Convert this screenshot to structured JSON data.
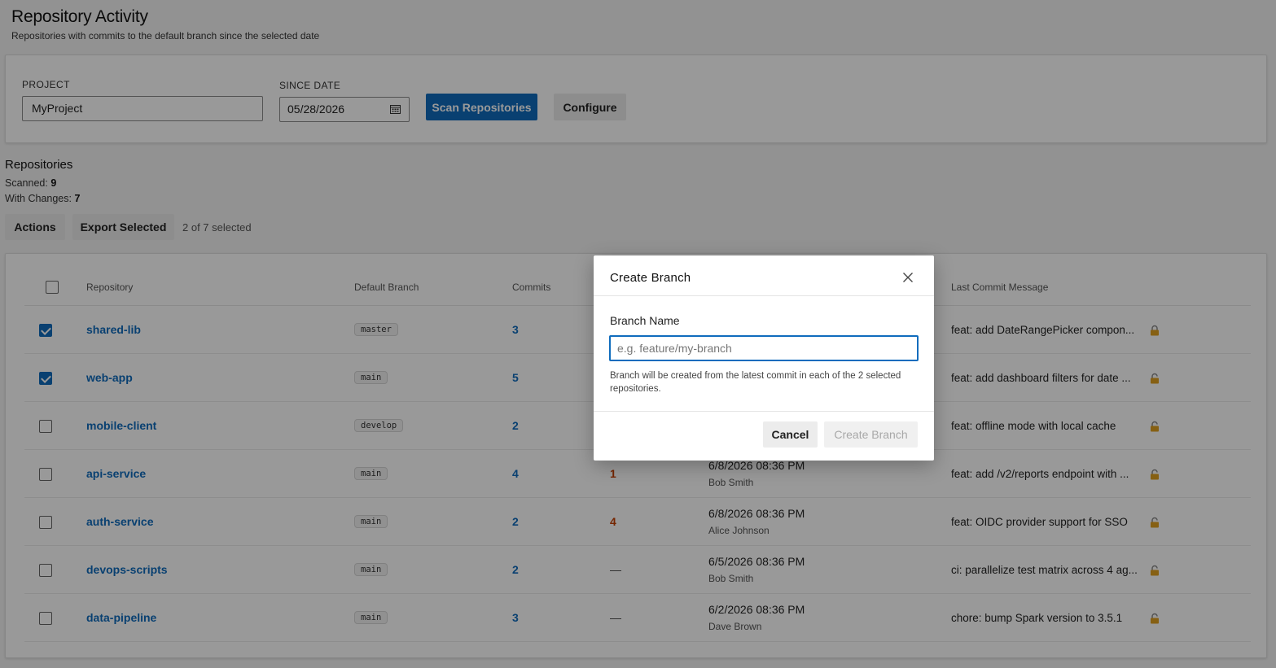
{
  "page": {
    "title": "Repository Activity",
    "subtitle": "Repositories with commits to the default branch since the selected date"
  },
  "filters": {
    "project_label": "PROJECT",
    "project_value": "MyProject",
    "since_label": "SINCE DATE",
    "since_value": "05/28/2026",
    "scan_button": "Scan Repositories",
    "configure_button": "Configure"
  },
  "summary": {
    "section_title": "Repositories",
    "scanned_label": "Scanned:",
    "scanned_value": "9",
    "changes_label": "With Changes:",
    "changes_value": "7",
    "actions_button": "Actions",
    "export_button": "Export Selected",
    "selected_text": "2 of 7 selected"
  },
  "table": {
    "headers": {
      "repository": "Repository",
      "default_branch": "Default Branch",
      "commits": "Commits",
      "last_commit_message": "Last Commit Message"
    },
    "rows": [
      {
        "selected": true,
        "repo": "shared-lib",
        "branch": "master",
        "commits": "3",
        "col4": "",
        "date": "",
        "author": "",
        "message": "feat: add DateRangePicker compon..."
      },
      {
        "selected": true,
        "repo": "web-app",
        "branch": "main",
        "commits": "5",
        "col4": "",
        "date": "",
        "author": "",
        "message": "feat: add dashboard filters for date ..."
      },
      {
        "selected": false,
        "repo": "mobile-client",
        "branch": "develop",
        "commits": "2",
        "col4": "",
        "date": "",
        "author": "",
        "message": "feat: offline mode with local cache"
      },
      {
        "selected": false,
        "repo": "api-service",
        "branch": "main",
        "commits": "4",
        "col4": "1",
        "date": "6/8/2026 08:36 PM",
        "author": "Bob Smith",
        "message": "feat: add /v2/reports endpoint with ..."
      },
      {
        "selected": false,
        "repo": "auth-service",
        "branch": "main",
        "commits": "2",
        "col4": "4",
        "date": "6/8/2026 08:36 PM",
        "author": "Alice Johnson",
        "message": "feat: OIDC provider support for SSO"
      },
      {
        "selected": false,
        "repo": "devops-scripts",
        "branch": "main",
        "commits": "2",
        "col4": "—",
        "date": "6/5/2026 08:36 PM",
        "author": "Bob Smith",
        "message": "ci: parallelize test matrix across 4 ag..."
      },
      {
        "selected": false,
        "repo": "data-pipeline",
        "branch": "main",
        "commits": "3",
        "col4": "—",
        "date": "6/2/2026 08:36 PM",
        "author": "Dave Brown",
        "message": "chore: bump Spark version to 3.5.1"
      }
    ]
  },
  "dialog": {
    "title": "Create Branch",
    "field_label": "Branch Name",
    "placeholder": "e.g. feature/my-branch",
    "help_text": "Branch will be created from the latest commit in each of the 2 selected repositories.",
    "cancel_button": "Cancel",
    "create_button": "Create Branch"
  },
  "colors": {
    "accent": "#0f6cbd",
    "warning": "#c43e00",
    "lock": "#e0a020"
  },
  "icons": [
    "calendar-icon",
    "close-icon",
    "lock-icon"
  ]
}
